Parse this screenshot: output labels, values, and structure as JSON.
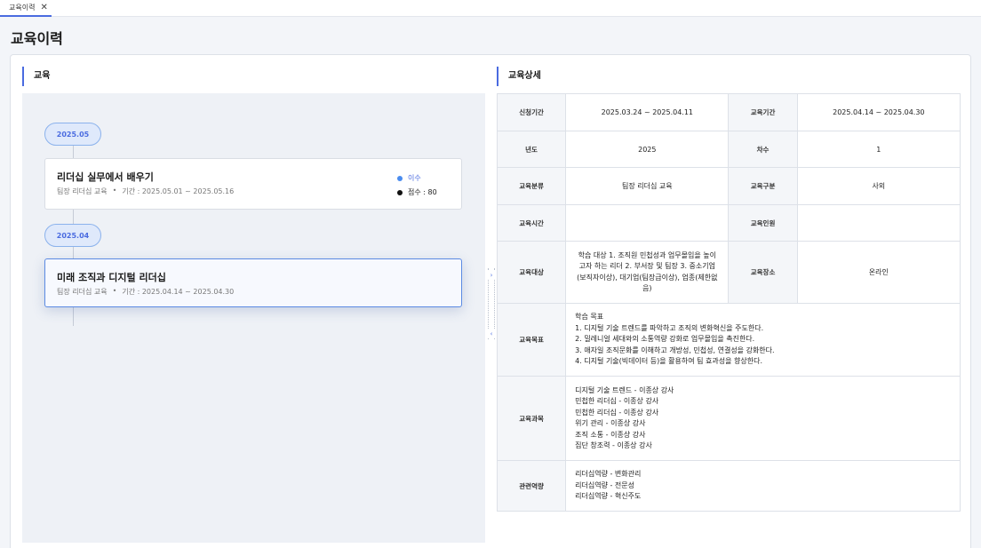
{
  "tabs": [
    {
      "label": "교육이력"
    }
  ],
  "page": {
    "title": "교육이력"
  },
  "left": {
    "section_title": "교육",
    "timeline": [
      {
        "date": "2025.05",
        "title": "리더십 실무에서 배우기",
        "category": "팀장 리더십 교육",
        "period": "기간 : 2025.05.01 ~ 2025.05.16",
        "status": "이수",
        "score": "점수 : 80"
      },
      {
        "date": "2025.04",
        "title": "미래 조직과 디지털 리더십",
        "category": "팀장 리더십 교육",
        "period": "기간 : 2025.04.14 ~ 2025.04.30"
      }
    ]
  },
  "right": {
    "section_title": "교육상세",
    "rows": {
      "apply_label": "신청기간",
      "apply_value": "2025.03.24 ~ 2025.04.11",
      "period_label": "교육기간",
      "period_value": "2025.04.14 ~ 2025.04.30",
      "year_label": "년도",
      "year_value": "2025",
      "round_label": "차수",
      "round_value": "1",
      "class_label": "교육분류",
      "class_value": "팀장 리더십 교육",
      "type_label": "교육구분",
      "type_value": "사외",
      "hours_label": "교육시간",
      "hours_value": "",
      "count_label": "교육인원",
      "count_value": "",
      "target_label": "교육대상",
      "target_value": "학습 대상 1. 조직원 민첩성과 업무몰입을 높이고자 하는 리더 2. 부서장 및 팀장 3. 중소기업(보직자이상), 대기업(팀장급이상), 업종(제한없음)",
      "place_label": "교육장소",
      "place_value": "온라인",
      "goal_label": "교육목표",
      "goal_value": "학습 목표\n1. 디지털 기술 트렌드를 파악하고 조직의 변화혁신을 주도한다.\n2. 밀레니얼 세대와의 소통역량 강화로 업무몰입을 촉진한다.\n3. 애자일 조직문화를 이해하고 개방성, 민첩성, 연결성을 강화한다.\n4. 디지털 기술(빅데이터 등)을 활용하여 팀 효과성을 향상한다.",
      "course_label": "교육과목",
      "course_value": "디지털 기술 트렌드 - 이종상 강사\n민첩한 리더십 - 이종상 강사\n민첩한 리더십 - 이종상 강사\n위기 관리 - 이종상 강사\n조직 소통 - 이종상 강사\n집단 창조력 - 이종상 강사",
      "comp_label": "관련역량",
      "comp_value": "리더십역량 - 변화관리\n리더십역량 - 전문성\n리더십역량 - 혁신주도"
    }
  },
  "colors": {
    "accent": "#4a6be0",
    "status_blue": "#4a8cef"
  },
  "icons": {
    "close": "close-icon",
    "expand_right": "chevron-right-icon",
    "collapse_left": "chevron-left-icon"
  }
}
